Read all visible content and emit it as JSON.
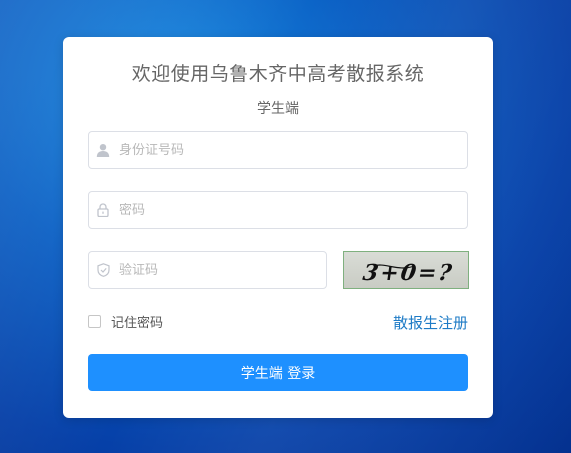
{
  "login": {
    "title": "欢迎使用乌鲁木齐中高考散报系统",
    "subtitle": "学生端",
    "id_field": {
      "placeholder": "身份证号码",
      "icon": "user-icon"
    },
    "password_field": {
      "placeholder": "密码",
      "icon": "lock-icon"
    },
    "captcha_field": {
      "placeholder": "验证码",
      "icon": "shield-icon"
    },
    "captcha_image_text": "3+0=?",
    "remember_label": "记住密码",
    "register_link": "散报生注册",
    "login_button": "学生端 登录"
  },
  "colors": {
    "primary_button": "#1e90ff",
    "link": "#1e7bc6",
    "background": "#0a5fc4"
  }
}
